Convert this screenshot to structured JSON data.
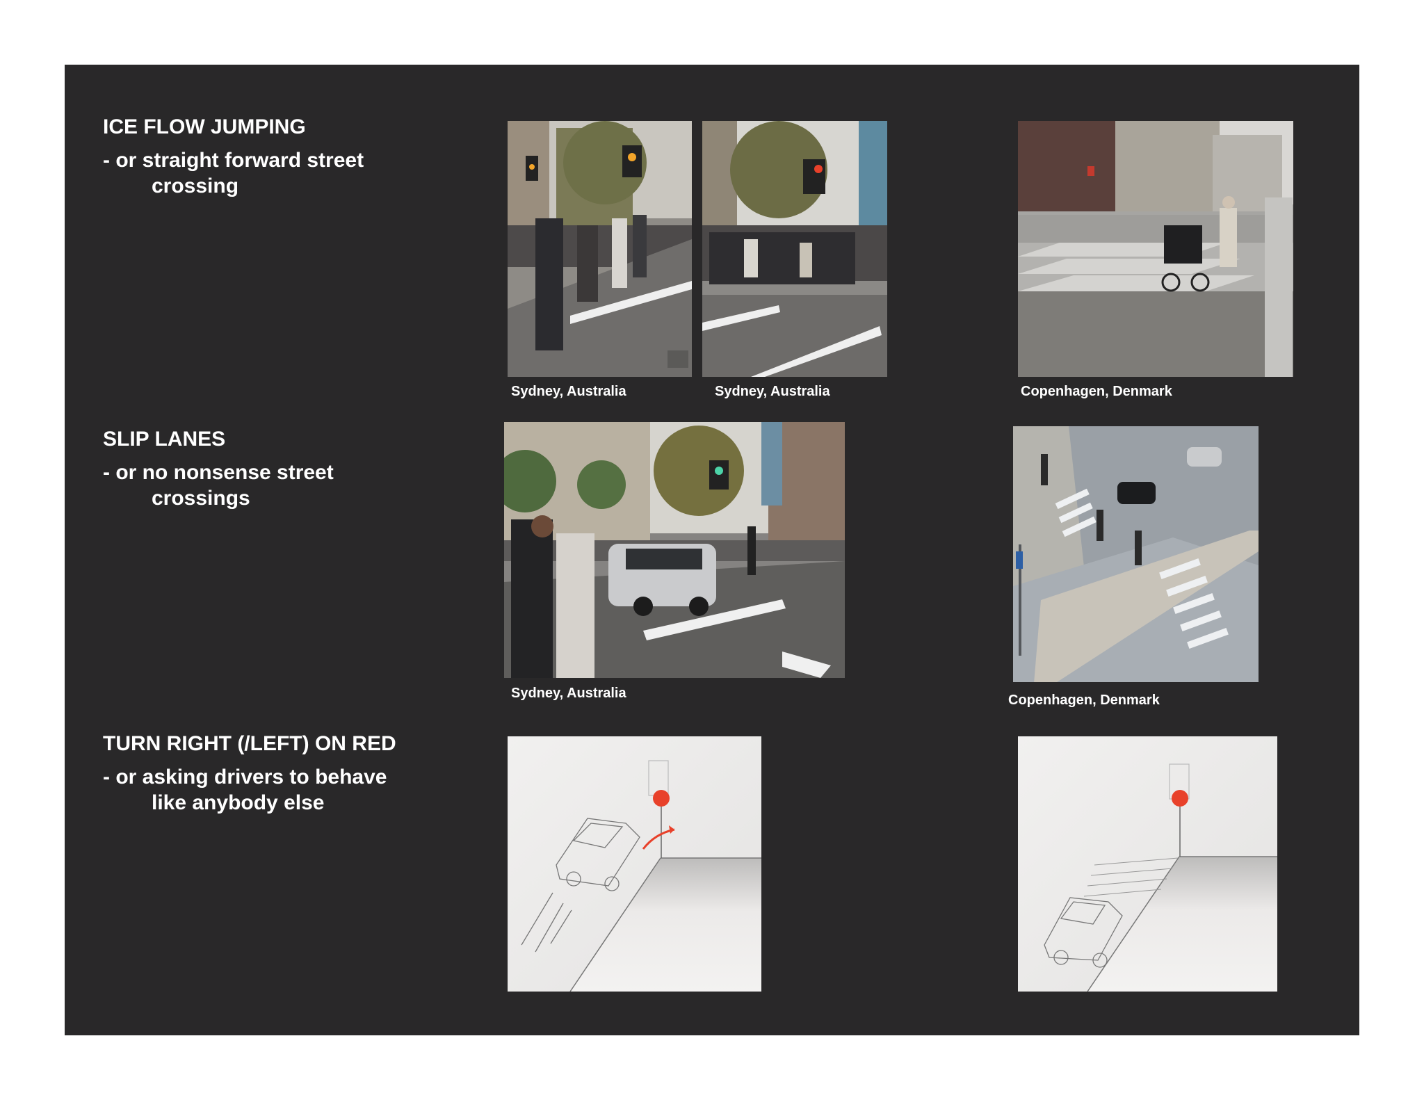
{
  "sections": [
    {
      "heading": "ICE FLOW JUMPING",
      "sub_line1": "- or straight forward street",
      "sub_line2": "crossing"
    },
    {
      "heading": "SLIP LANES",
      "sub_line1": "- or no nonsense street",
      "sub_line2": "crossings"
    },
    {
      "heading": "TURN RIGHT (/LEFT) ON RED",
      "sub_line1": "- or asking drivers to behave",
      "sub_line2": "like anybody else"
    }
  ],
  "captions": {
    "sydney_1": "Sydney, Australia",
    "sydney_2": "Sydney, Australia",
    "copenhagen_1": "Copenhagen, Denmark",
    "sydney_3": "Sydney, Australia",
    "copenhagen_2": "Copenhagen, Denmark"
  },
  "colors": {
    "panel_background": "#292829",
    "text": "#ffffff",
    "signal_red": "#e8412a"
  }
}
